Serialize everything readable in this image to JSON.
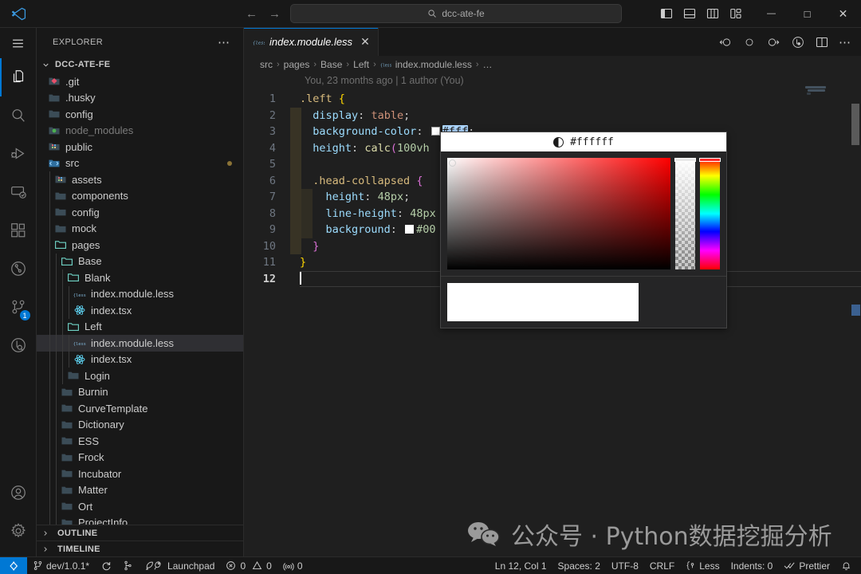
{
  "titlebar": {
    "logo_icon": "vscode-logo-icon",
    "back_icon": "arrow-left-icon",
    "forward_icon": "arrow-right-icon",
    "command_center": {
      "icon": "search-icon",
      "text": "dcc-ate-fe"
    },
    "layout_buttons": [
      {
        "name": "toggle-primary-sidebar",
        "icon": "layout-sidebar-left-icon"
      },
      {
        "name": "toggle-panel",
        "icon": "layout-panel-icon"
      },
      {
        "name": "toggle-secondary-sidebar",
        "icon": "layout-sidebar-right-icon"
      },
      {
        "name": "customize-layout",
        "icon": "layout-customize-icon"
      }
    ],
    "window_controls": [
      {
        "name": "minimize-button",
        "glyph": "—"
      },
      {
        "name": "maximize-button",
        "glyph": "□"
      },
      {
        "name": "close-button",
        "glyph": "✕"
      }
    ]
  },
  "activitybar": {
    "menu_icon": "hamburger-menu-icon",
    "items": [
      {
        "name": "explorer",
        "icon": "files-icon",
        "active": true,
        "badge": ""
      },
      {
        "name": "search",
        "icon": "search-icon",
        "active": false,
        "badge": ""
      },
      {
        "name": "run-and-debug",
        "icon": "run-debug-icon",
        "active": false,
        "badge": ""
      },
      {
        "name": "remote-explorer",
        "icon": "remote-explorer-icon",
        "active": false,
        "badge": ""
      },
      {
        "name": "extensions",
        "icon": "extensions-icon",
        "active": false,
        "badge": ""
      },
      {
        "name": "test-explorer",
        "icon": "circle-branch-icon",
        "active": false,
        "badge": ""
      },
      {
        "name": "source-control",
        "icon": "source-control-icon",
        "active": false,
        "badge": "1"
      },
      {
        "name": "gitlens",
        "icon": "gitlens-icon",
        "active": false,
        "badge": ""
      }
    ],
    "bottom_items": [
      {
        "name": "accounts",
        "icon": "account-icon"
      },
      {
        "name": "manage-settings",
        "icon": "gear-icon"
      }
    ]
  },
  "sidebar": {
    "title": "EXPLORER",
    "more_actions": "⋯",
    "root_folder": "DCC-ATE-FE",
    "tree": [
      {
        "label": ".git",
        "indent": 1,
        "type": "folder-git",
        "dim": false,
        "selected": false,
        "modified": false
      },
      {
        "label": ".husky",
        "indent": 1,
        "type": "folder",
        "dim": false,
        "selected": false,
        "modified": false
      },
      {
        "label": "config",
        "indent": 1,
        "type": "folder",
        "dim": false,
        "selected": false,
        "modified": false
      },
      {
        "label": "node_modules",
        "indent": 1,
        "type": "folder-node",
        "dim": true,
        "selected": false,
        "modified": false
      },
      {
        "label": "public",
        "indent": 1,
        "type": "folder-public",
        "dim": false,
        "selected": false,
        "modified": false
      },
      {
        "label": "src",
        "indent": 1,
        "type": "folder-src",
        "dim": false,
        "selected": false,
        "modified": true
      },
      {
        "label": "assets",
        "indent": 2,
        "type": "folder-assets",
        "dim": false,
        "selected": false,
        "modified": false
      },
      {
        "label": "components",
        "indent": 2,
        "type": "folder",
        "dim": false,
        "selected": false,
        "modified": false
      },
      {
        "label": "config",
        "indent": 2,
        "type": "folder",
        "dim": false,
        "selected": false,
        "modified": false
      },
      {
        "label": "mock",
        "indent": 2,
        "type": "folder",
        "dim": false,
        "selected": false,
        "modified": false
      },
      {
        "label": "pages",
        "indent": 2,
        "type": "folder-open",
        "dim": false,
        "selected": false,
        "modified": false
      },
      {
        "label": "Base",
        "indent": 3,
        "type": "folder-open",
        "dim": false,
        "selected": false,
        "modified": false
      },
      {
        "label": "Blank",
        "indent": 4,
        "type": "folder-open",
        "dim": false,
        "selected": false,
        "modified": false
      },
      {
        "label": "index.module.less",
        "indent": 5,
        "type": "file-less",
        "dim": false,
        "selected": false,
        "modified": false
      },
      {
        "label": "index.tsx",
        "indent": 5,
        "type": "file-react",
        "dim": false,
        "selected": false,
        "modified": false
      },
      {
        "label": "Left",
        "indent": 4,
        "type": "folder-open",
        "dim": false,
        "selected": false,
        "modified": false
      },
      {
        "label": "index.module.less",
        "indent": 5,
        "type": "file-less",
        "dim": false,
        "selected": true,
        "modified": false
      },
      {
        "label": "index.tsx",
        "indent": 5,
        "type": "file-react",
        "dim": false,
        "selected": false,
        "modified": false
      },
      {
        "label": "Login",
        "indent": 4,
        "type": "folder",
        "dim": false,
        "selected": false,
        "modified": false
      },
      {
        "label": "Burnin",
        "indent": 3,
        "type": "folder",
        "dim": false,
        "selected": false,
        "modified": false
      },
      {
        "label": "CurveTemplate",
        "indent": 3,
        "type": "folder",
        "dim": false,
        "selected": false,
        "modified": false
      },
      {
        "label": "Dictionary",
        "indent": 3,
        "type": "folder",
        "dim": false,
        "selected": false,
        "modified": false
      },
      {
        "label": "ESS",
        "indent": 3,
        "type": "folder",
        "dim": false,
        "selected": false,
        "modified": false
      },
      {
        "label": "Frock",
        "indent": 3,
        "type": "folder",
        "dim": false,
        "selected": false,
        "modified": false
      },
      {
        "label": "Incubator",
        "indent": 3,
        "type": "folder",
        "dim": false,
        "selected": false,
        "modified": false
      },
      {
        "label": "Matter",
        "indent": 3,
        "type": "folder",
        "dim": false,
        "selected": false,
        "modified": false
      },
      {
        "label": "Ort",
        "indent": 3,
        "type": "folder",
        "dim": false,
        "selected": false,
        "modified": false
      },
      {
        "label": "ProjectInfo",
        "indent": 3,
        "type": "folder",
        "dim": false,
        "selected": false,
        "modified": false
      }
    ],
    "outline_label": "OUTLINE",
    "timeline_label": "TIMELINE"
  },
  "editor": {
    "tab": {
      "label": "index.module.less",
      "icon": "less-file-icon",
      "close_glyph": "✕"
    },
    "actions": [
      {
        "name": "go-to-previous-change",
        "icon": "arrow-circle-left-icon"
      },
      {
        "name": "toggle-change",
        "icon": "circle-icon"
      },
      {
        "name": "go-to-next-change",
        "icon": "arrow-circle-right-icon"
      },
      {
        "name": "run-or-debug",
        "icon": "run-circle-icon"
      },
      {
        "name": "split-editor-right",
        "icon": "split-editor-icon"
      },
      {
        "name": "more-actions",
        "icon": "ellipsis-icon"
      }
    ],
    "breadcrumbs": [
      "src",
      "pages",
      "Base",
      "Left",
      "index.module.less",
      "…"
    ],
    "breadcrumb_file_icon": "less-file-icon",
    "blame": "You, 23 months ago | 1 author (You)",
    "lines": [
      {
        "no": "1",
        "tokens": [
          {
            "t": ".left",
            "c": "s-sel"
          },
          {
            "t": " ",
            "c": "s-punc"
          },
          {
            "t": "{",
            "c": "s-brace"
          }
        ]
      },
      {
        "no": "2",
        "tokens": [
          {
            "t": "  ",
            "c": "s-punc"
          },
          {
            "t": "display",
            "c": "s-prop"
          },
          {
            "t": ": ",
            "c": "s-punc"
          },
          {
            "t": "table",
            "c": "s-val"
          },
          {
            "t": ";",
            "c": "s-punc"
          }
        ]
      },
      {
        "no": "3",
        "tokens": [
          {
            "t": "  ",
            "c": "s-punc"
          },
          {
            "t": "background-color",
            "c": "s-prop"
          },
          {
            "t": ": ",
            "c": "s-punc"
          },
          {
            "t": "__SWATCH__",
            "c": ""
          },
          {
            "t": "#fff",
            "c": "selhl"
          },
          {
            "t": ";",
            "c": "s-punc"
          }
        ]
      },
      {
        "no": "4",
        "tokens": [
          {
            "t": "  ",
            "c": "s-punc"
          },
          {
            "t": "height",
            "c": "s-prop"
          },
          {
            "t": ": ",
            "c": "s-punc"
          },
          {
            "t": "calc",
            "c": "s-fn"
          },
          {
            "t": "(",
            "c": "s-paren"
          },
          {
            "t": "100vh",
            "c": "s-num"
          }
        ]
      },
      {
        "no": "5",
        "tokens": []
      },
      {
        "no": "6",
        "tokens": [
          {
            "t": "  ",
            "c": "s-punc"
          },
          {
            "t": ".head-collapsed",
            "c": "s-sel"
          },
          {
            "t": " ",
            "c": "s-punc"
          },
          {
            "t": "{",
            "c": "s-brace2"
          }
        ]
      },
      {
        "no": "7",
        "tokens": [
          {
            "t": "    ",
            "c": "s-punc"
          },
          {
            "t": "height",
            "c": "s-prop"
          },
          {
            "t": ": ",
            "c": "s-punc"
          },
          {
            "t": "48px",
            "c": "s-num"
          },
          {
            "t": ";",
            "c": "s-punc"
          }
        ]
      },
      {
        "no": "8",
        "tokens": [
          {
            "t": "    ",
            "c": "s-punc"
          },
          {
            "t": "line-height",
            "c": "s-prop"
          },
          {
            "t": ": ",
            "c": "s-punc"
          },
          {
            "t": "48px",
            "c": "s-num"
          }
        ]
      },
      {
        "no": "9",
        "tokens": [
          {
            "t": "    ",
            "c": "s-punc"
          },
          {
            "t": "background",
            "c": "s-prop"
          },
          {
            "t": ": ",
            "c": "s-punc"
          },
          {
            "t": "__SWATCH_DARK__",
            "c": ""
          },
          {
            "t": "#00",
            "c": "s-num"
          }
        ]
      },
      {
        "no": "10",
        "tokens": [
          {
            "t": "  ",
            "c": "s-punc"
          },
          {
            "t": "}",
            "c": "s-brace2"
          }
        ]
      },
      {
        "no": "11",
        "tokens": [
          {
            "t": "}",
            "c": "s-brace"
          }
        ]
      },
      {
        "no": "12",
        "tokens": [
          {
            "t": "__CARET__",
            "c": ""
          }
        ]
      }
    ]
  },
  "colorpicker": {
    "contrast_icon": "contrast-icon",
    "value": "#ffffff",
    "preview_color": "#ffffff"
  },
  "watermark": {
    "icon": "wechat-icon",
    "text": "公众号 · Python数据挖掘分析"
  },
  "statusbar": {
    "remote_icon": "remote-window-icon",
    "left": [
      {
        "name": "git-branch",
        "icon": "source-control-icon",
        "label": "dev/1.0.1*"
      },
      {
        "name": "sync-changes",
        "icon": "sync-icon",
        "label": ""
      },
      {
        "name": "git-graph",
        "icon": "git-graph-icon",
        "label": ""
      },
      {
        "name": "launchpad",
        "icon": "launchpad-icon",
        "label": "Launchpad"
      },
      {
        "name": "problems",
        "icon": "error-warning-icon",
        "label": "0  0"
      },
      {
        "name": "ports",
        "icon": "radio-tower-icon",
        "label": "0"
      }
    ],
    "right": [
      {
        "name": "editor-position",
        "label": "Ln 12, Col 1"
      },
      {
        "name": "indentation",
        "label": "Spaces: 2"
      },
      {
        "name": "encoding",
        "label": "UTF-8"
      },
      {
        "name": "eol",
        "label": "CRLF"
      },
      {
        "name": "language-mode",
        "icon": "less-lang-icon",
        "label": "Less"
      },
      {
        "name": "indents",
        "label": "Indents: 0"
      },
      {
        "name": "prettier",
        "icon": "check-check-icon",
        "label": "Prettier"
      },
      {
        "name": "notifications",
        "icon": "bell-icon",
        "label": ""
      }
    ],
    "problems_errors": "0",
    "problems_warnings": "0"
  },
  "colors": {
    "accent": "#0078d4",
    "titlebar_bg": "#181818",
    "editor_bg": "#1f1f1f",
    "selection": "#add6ff"
  }
}
